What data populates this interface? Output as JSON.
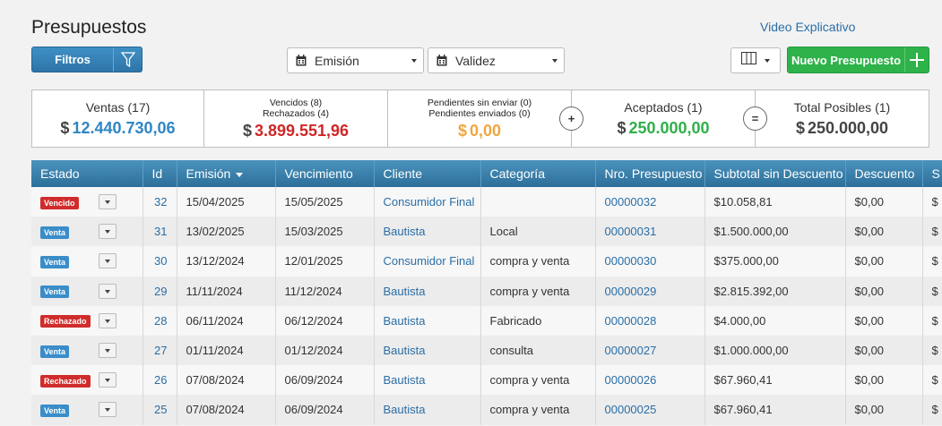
{
  "header": {
    "title": "Presupuestos",
    "video_link": "Video Explicativo",
    "filter_label": "Filtros",
    "date_filters": [
      "Emisión",
      "Validez"
    ],
    "new_label": "Nuevo Presupuesto"
  },
  "summary": {
    "ventas": {
      "label": "Ventas (17)",
      "currency": "$",
      "value": "12.440.730,06",
      "color": "#2f86c5"
    },
    "vencidos": {
      "line1": "Vencidos (8)",
      "line2": "Rechazados (4)",
      "currency": "$",
      "value": "3.899.551,96",
      "color": "#cf2626"
    },
    "pendientes": {
      "line1": "Pendientes sin enviar (0)",
      "line2": "Pendientes enviados (0)",
      "currency": "$",
      "value": "0,00",
      "color": "#f0a640"
    },
    "aceptados": {
      "label": "Aceptados (1)",
      "currency": "$",
      "value": "250.000,00",
      "color": "#2eb04a"
    },
    "total": {
      "label": "Total Posibles (1)",
      "currency": "$",
      "value": "250.000,00",
      "color": "#444444"
    },
    "op_plus": "+",
    "op_equals": "="
  },
  "table": {
    "columns": [
      "Estado",
      "Id",
      "Emisión",
      "Vencimiento",
      "Cliente",
      "Categoría",
      "Nro. Presupuesto",
      "Subtotal sin Descuento",
      "Descuento",
      "S"
    ],
    "rows": [
      {
        "estado": "Vencido",
        "type": "red",
        "id": "32",
        "emision": "15/04/2025",
        "vencimiento": "15/05/2025",
        "cliente": "Consumidor Final",
        "categoria": "",
        "nro": "00000032",
        "subtotal": "$10.058,81",
        "descuento": "$0,00",
        "extra": "$"
      },
      {
        "estado": "Venta",
        "type": "blue",
        "id": "31",
        "emision": "13/02/2025",
        "vencimiento": "15/03/2025",
        "cliente": "Bautista",
        "categoria": "Local",
        "nro": "00000031",
        "subtotal": "$1.500.000,00",
        "descuento": "$0,00",
        "extra": "$"
      },
      {
        "estado": "Venta",
        "type": "blue",
        "id": "30",
        "emision": "13/12/2024",
        "vencimiento": "12/01/2025",
        "cliente": "Consumidor Final",
        "categoria": "compra y venta",
        "nro": "00000030",
        "subtotal": "$375.000,00",
        "descuento": "$0,00",
        "extra": "$"
      },
      {
        "estado": "Venta",
        "type": "blue",
        "id": "29",
        "emision": "11/11/2024",
        "vencimiento": "11/12/2024",
        "cliente": "Bautista",
        "categoria": "compra y venta",
        "nro": "00000029",
        "subtotal": "$2.815.392,00",
        "descuento": "$0,00",
        "extra": "$"
      },
      {
        "estado": "Rechazado",
        "type": "red",
        "id": "28",
        "emision": "06/11/2024",
        "vencimiento": "06/12/2024",
        "cliente": "Bautista",
        "categoria": "Fabricado",
        "nro": "00000028",
        "subtotal": "$4.000,00",
        "descuento": "$0,00",
        "extra": "$"
      },
      {
        "estado": "Venta",
        "type": "blue",
        "id": "27",
        "emision": "01/11/2024",
        "vencimiento": "01/12/2024",
        "cliente": "Bautista",
        "categoria": "consulta",
        "nro": "00000027",
        "subtotal": "$1.000.000,00",
        "descuento": "$0,00",
        "extra": "$"
      },
      {
        "estado": "Rechazado",
        "type": "red",
        "id": "26",
        "emision": "07/08/2024",
        "vencimiento": "06/09/2024",
        "cliente": "Bautista",
        "categoria": "compra y venta",
        "nro": "00000026",
        "subtotal": "$67.960,41",
        "descuento": "$0,00",
        "extra": "$"
      },
      {
        "estado": "Venta",
        "type": "blue",
        "id": "25",
        "emision": "07/08/2024",
        "vencimiento": "06/09/2024",
        "cliente": "Bautista",
        "categoria": "compra y venta",
        "nro": "00000025",
        "subtotal": "$67.960,41",
        "descuento": "$0,00",
        "extra": "$"
      }
    ]
  }
}
